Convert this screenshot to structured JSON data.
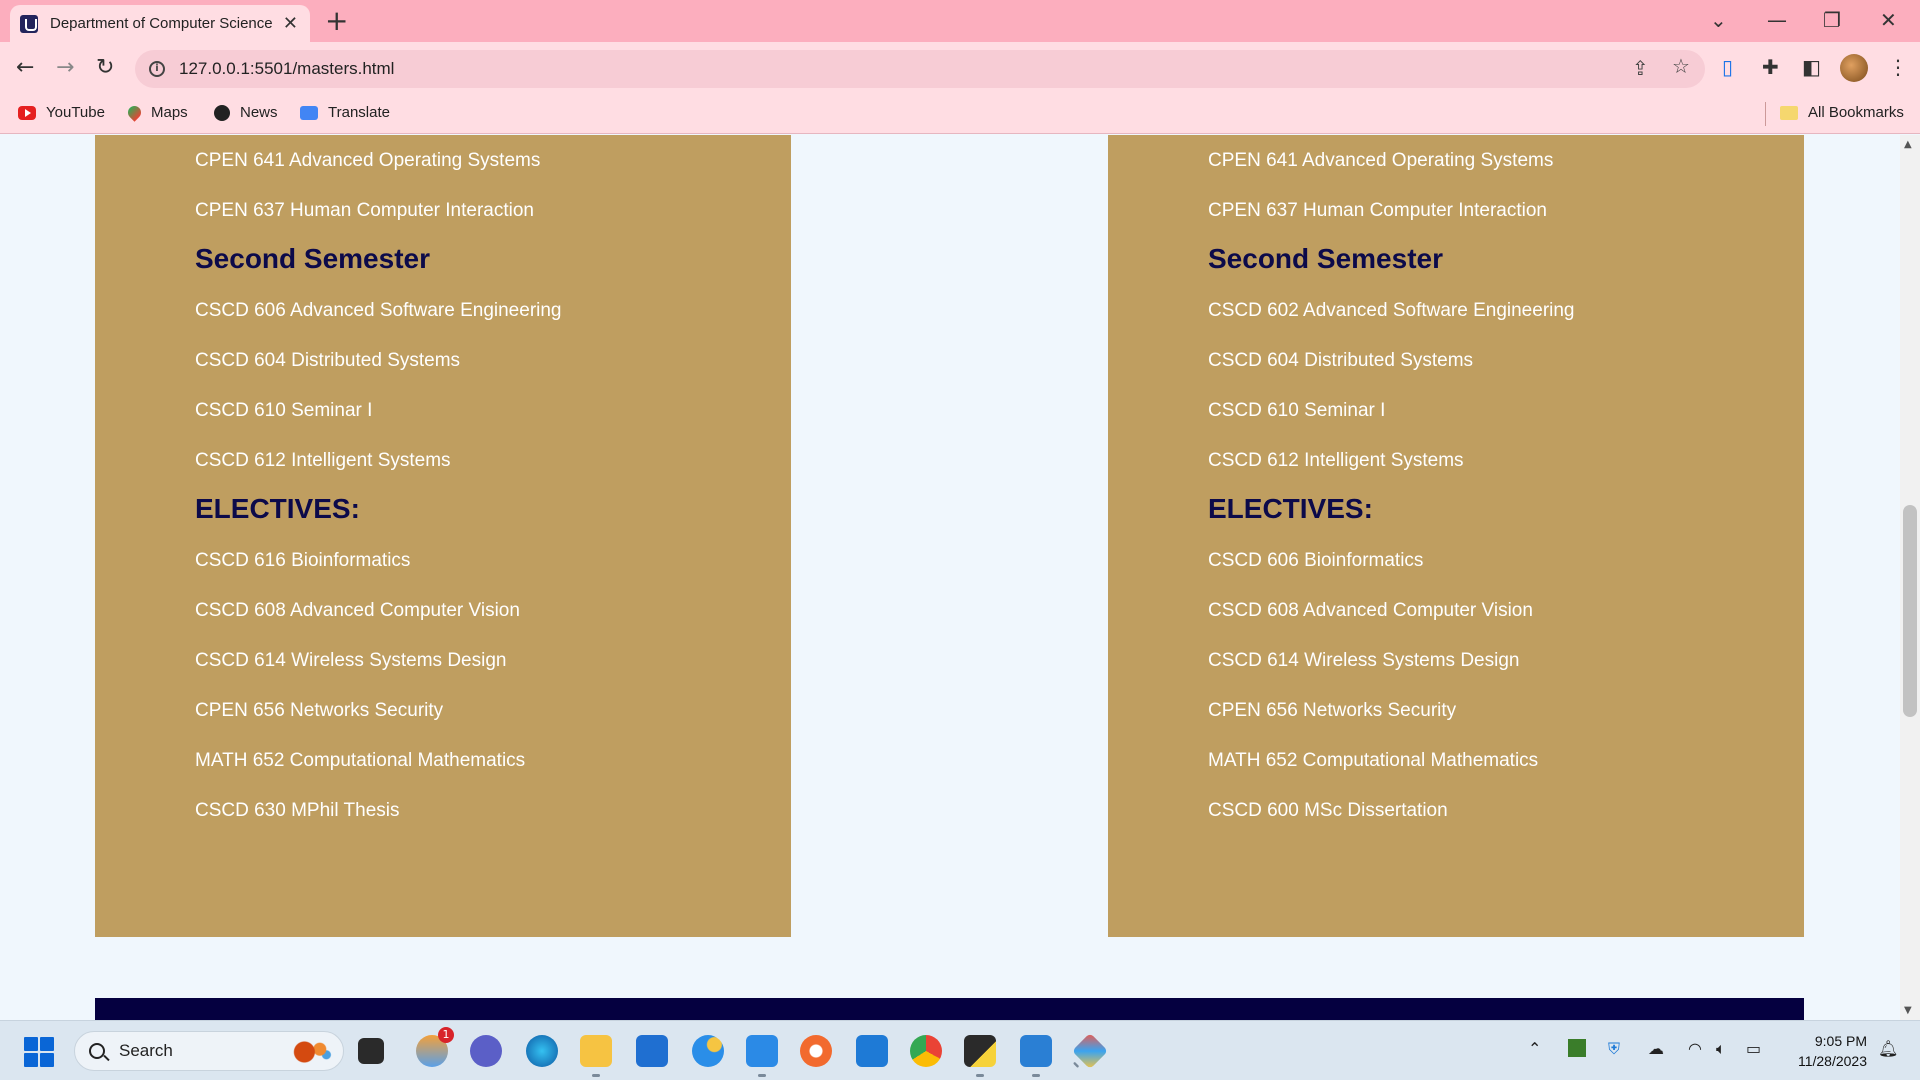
{
  "browser": {
    "tab_title": "Department of Computer Science",
    "url": "127.0.0.1:5501/masters.html",
    "bookmarks": [
      {
        "label": "YouTube",
        "icon": "youtube-icon"
      },
      {
        "label": "Maps",
        "icon": "maps-icon"
      },
      {
        "label": "News",
        "icon": "news-icon"
      },
      {
        "label": "Translate",
        "icon": "translate-icon"
      }
    ],
    "all_bookmarks": "All Bookmarks"
  },
  "page": {
    "background": "#f0f7fd",
    "panel_color": "#bf9e60",
    "heading_color": "#0c0a4a",
    "panels": [
      {
        "first_semester_tail": [
          "CPEN 641 Advanced Operating Systems",
          "CPEN 637 Human Computer Interaction"
        ],
        "second_semester_heading": "Second Semester",
        "second_semester": [
          "CSCD 606 Advanced Software Engineering",
          "CSCD 604 Distributed Systems",
          "CSCD 610 Seminar I",
          "CSCD 612 Intelligent Systems"
        ],
        "electives_heading": "ELECTIVES:",
        "electives": [
          "CSCD 616 Bioinformatics",
          "CSCD 608 Advanced Computer Vision",
          "CSCD 614 Wireless Systems Design",
          "CPEN 656 Networks Security",
          "MATH 652 Computational Mathematics",
          "CSCD 630 MPhil Thesis"
        ]
      },
      {
        "first_semester_tail": [
          "CPEN 641 Advanced Operating Systems",
          "CPEN 637 Human Computer Interaction"
        ],
        "second_semester_heading": "Second Semester",
        "second_semester": [
          "CSCD 602 Advanced Software Engineering",
          "CSCD 604 Distributed Systems",
          "CSCD 610 Seminar I",
          "CSCD 612 Intelligent Systems"
        ],
        "electives_heading": "ELECTIVES:",
        "electives": [
          "CSCD 606 Bioinformatics",
          "CSCD 608 Advanced Computer Vision",
          "CSCD 614 Wireless Systems Design",
          "CPEN 656 Networks Security",
          "MATH 652 Computational Mathematics",
          "CSCD 600 MSc Dissertation"
        ]
      }
    ]
  },
  "taskbar": {
    "search_placeholder": "Search",
    "notification_badge": "1",
    "time": "9:05 PM",
    "date": "11/28/2023"
  }
}
